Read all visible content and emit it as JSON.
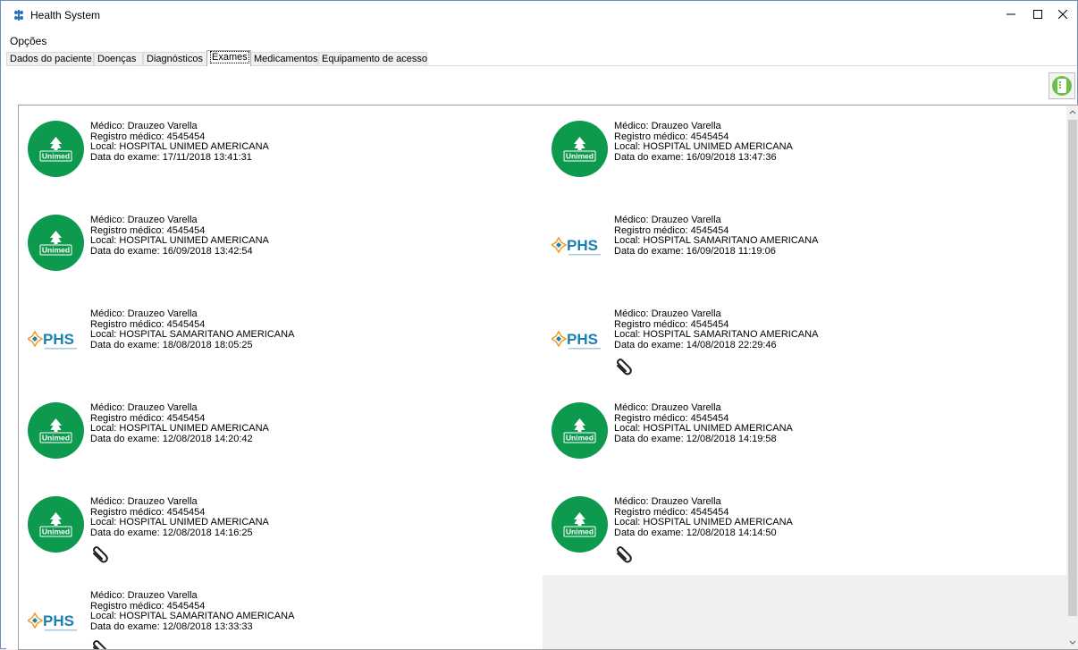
{
  "window": {
    "title": "Health System"
  },
  "menu": {
    "options_label": "Opções"
  },
  "tabs": [
    {
      "label": "Dados do paciente"
    },
    {
      "label": "Doenças"
    },
    {
      "label": "Diagnósticos"
    },
    {
      "label": "Exames"
    },
    {
      "label": "Medicamentos"
    },
    {
      "label": "Equipamento de acesso"
    }
  ],
  "selected_tab": "Exames",
  "exams": [
    {
      "doctor": "Médico: Drauzeo Varella",
      "registry": "Registro médico: 4545454",
      "location": "Local: HOSPITAL UNIMED AMERICANA",
      "date": "Data do exame: 17/11/2018 13:41:31",
      "logo": "unimed-logo",
      "logo_text": "Unimed",
      "attachment": false
    },
    {
      "doctor": "Médico: Drauzeo Varella",
      "registry": "Registro médico: 4545454",
      "location": "Local: HOSPITAL UNIMED AMERICANA",
      "date": "Data do exame: 16/09/2018 13:47:36",
      "logo": "unimed-logo",
      "logo_text": "Unimed",
      "attachment": false
    },
    {
      "doctor": "Médico: Drauzeo Varella",
      "registry": "Registro médico: 4545454",
      "location": "Local: HOSPITAL UNIMED AMERICANA",
      "date": "Data do exame: 16/09/2018 13:42:54",
      "logo": "unimed-logo",
      "logo_text": "Unimed",
      "attachment": false
    },
    {
      "doctor": "Médico: Drauzeo Varella",
      "registry": "Registro médico: 4545454",
      "location": "Local: HOSPITAL SAMARITANO AMERICANA",
      "date": "Data do exame: 16/09/2018 11:19:06",
      "logo": "phs-logo",
      "logo_text": "PHS",
      "attachment": false
    },
    {
      "doctor": "Médico: Drauzeo Varella",
      "registry": "Registro médico: 4545454",
      "location": "Local: HOSPITAL SAMARITANO AMERICANA",
      "date": "Data do exame: 18/08/2018 18:05:25",
      "logo": "phs-logo",
      "logo_text": "PHS",
      "attachment": false
    },
    {
      "doctor": "Médico: Drauzeo Varella",
      "registry": "Registro médico: 4545454",
      "location": "Local: HOSPITAL SAMARITANO AMERICANA",
      "date": "Data do exame: 14/08/2018 22:29:46",
      "logo": "phs-logo",
      "logo_text": "PHS",
      "attachment": true
    },
    {
      "doctor": "Médico: Drauzeo Varella",
      "registry": "Registro médico: 4545454",
      "location": "Local: HOSPITAL UNIMED AMERICANA",
      "date": "Data do exame: 12/08/2018 14:20:42",
      "logo": "unimed-logo",
      "logo_text": "Unimed",
      "attachment": false
    },
    {
      "doctor": "Médico: Drauzeo Varella",
      "registry": "Registro médico: 4545454",
      "location": "Local: HOSPITAL UNIMED AMERICANA",
      "date": "Data do exame: 12/08/2018 14:19:58",
      "logo": "unimed-logo",
      "logo_text": "Unimed",
      "attachment": false
    },
    {
      "doctor": "Médico: Drauzeo Varella",
      "registry": "Registro médico: 4545454",
      "location": "Local: HOSPITAL UNIMED AMERICANA",
      "date": "Data do exame: 12/08/2018 14:16:25",
      "logo": "unimed-logo",
      "logo_text": "Unimed",
      "attachment": true
    },
    {
      "doctor": "Médico: Drauzeo Varella",
      "registry": "Registro médico: 4545454",
      "location": "Local: HOSPITAL UNIMED AMERICANA",
      "date": "Data do exame: 12/08/2018 14:14:50",
      "logo": "unimed-logo",
      "logo_text": "Unimed",
      "attachment": true
    },
    {
      "doctor": "Médico: Drauzeo Varella",
      "registry": "Registro médico: 4545454",
      "location": "Local: HOSPITAL SAMARITANO AMERICANA",
      "date": "Data do exame: 12/08/2018 13:33:33",
      "logo": "phs-logo",
      "logo_text": "PHS",
      "attachment": true
    }
  ],
  "colors": {
    "unimed_green": "#0e9a4e",
    "phs_blue": "#1a7fb4",
    "phs_orange": "#f29a1b",
    "sync_green": "#6cc04a"
  }
}
